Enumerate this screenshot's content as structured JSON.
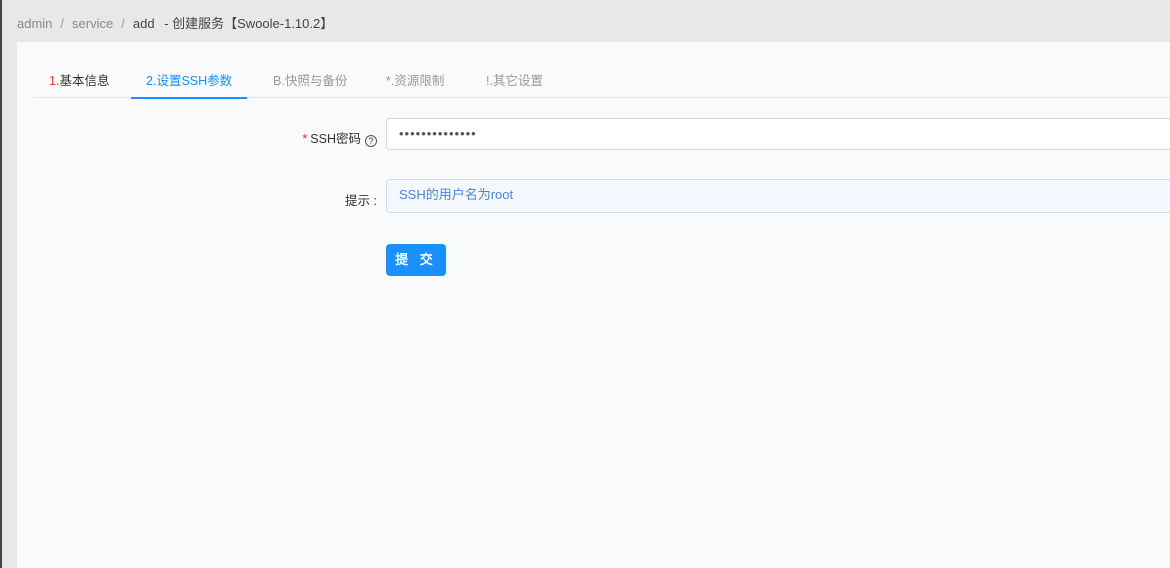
{
  "breadcrumb": [
    "admin",
    "service",
    "add"
  ],
  "breadcrumb_sep": "/",
  "page_title": "-  创建服务【Swoole-1.10.2】",
  "tabs": [
    {
      "num": "1.",
      "label": "基本信息"
    },
    {
      "num": "2.",
      "label": "设置SSH参数"
    },
    {
      "num": "B.",
      "label": "快照与备份"
    },
    {
      "num": "*.",
      "label": "资源限制"
    },
    {
      "num": "!.",
      "label": "其它设置"
    }
  ],
  "form": {
    "password": {
      "required_mark": "*",
      "label": "SSH密码",
      "help": "?",
      "value": "••••••••••••••"
    },
    "hint": {
      "label": "提示 :",
      "value": "SSH的用户名为root"
    },
    "submit_label": "提 交"
  },
  "colors": {
    "primary": "#1890ff",
    "required": "#f5222d"
  }
}
